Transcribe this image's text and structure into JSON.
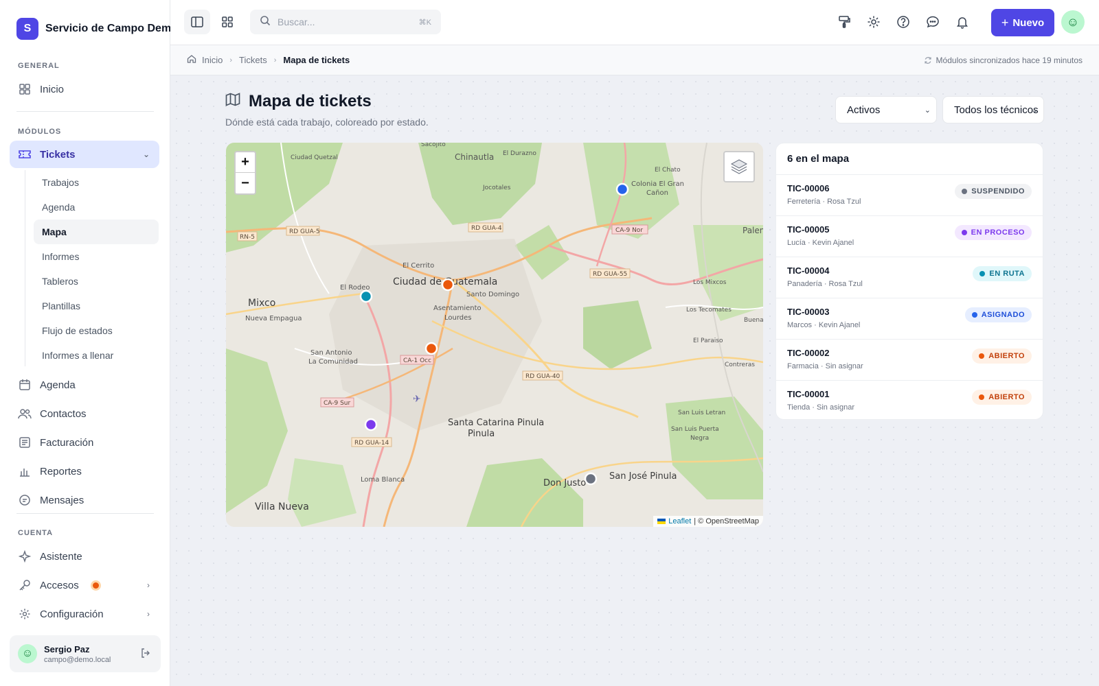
{
  "brand": {
    "logo_letter": "S",
    "name": "Servicio de Campo Demo"
  },
  "sidebar": {
    "general_label": "GENERAL",
    "inicio": "Inicio",
    "modulos_label": "MÓDULOS",
    "tickets": "Tickets",
    "tickets_sub": [
      "Trabajos",
      "Agenda",
      "Mapa",
      "Informes",
      "Tableros",
      "Plantillas",
      "Flujo de estados",
      "Informes a llenar"
    ],
    "modules": [
      "Agenda",
      "Contactos",
      "Facturación",
      "Reportes",
      "Mensajes"
    ],
    "cuenta_label": "CUENTA",
    "asistente": "Asistente",
    "accesos": "Accesos",
    "configuracion": "Configuración",
    "user": {
      "name": "Sergio Paz",
      "email": "campo@demo.local"
    }
  },
  "topbar": {
    "search_placeholder": "Buscar...",
    "search_shortcut": "⌘K",
    "new_label": "Nuevo"
  },
  "breadcrumb": {
    "home": "Inicio",
    "section": "Tickets",
    "current": "Mapa de tickets",
    "sync": "Módulos sincronizados hace 19 minutos"
  },
  "page": {
    "title": "Mapa de tickets",
    "subtitle": "Dónde está cada trabajo, coloreado por estado.",
    "filter_status": "Activos",
    "filter_tech": "Todos los técnicos"
  },
  "map": {
    "zoom_in": "+",
    "zoom_out": "−",
    "attribution_link": "Leaflet",
    "attribution_text": "| © OpenStreetMap",
    "labels": {
      "big": [
        "Ciudad de Guatemala",
        "Mixco",
        "Santa Catarina Pinula",
        "Villa Nueva",
        "San José Pinula",
        "Don Justo"
      ],
      "mid": [
        "Chinautla",
        "El Cerrito",
        "El Rodeo",
        "Santo Domingo",
        "Asentamiento Lourdes",
        "San Antonio La Comunidad",
        "Nueva Empagua",
        "Loma Blanca",
        "Colonia El Gran Cañon",
        "Los Mixcos",
        "Los Tecomates",
        "El Paraiso",
        "Contreras",
        "San Luis Letran",
        "San Luis Puerta Negra",
        "Ciudad Quetzal",
        "El Durazno",
        "Jocotales",
        "El Chato",
        "Sacojito",
        "Palenc",
        "Buena"
      ],
      "roads": [
        "RD GUA-5",
        "RN-5",
        "RD GUA-4",
        "CA-9 Nor",
        "RD GUA-55",
        "CA-1 Occ",
        "RD GUA-40",
        "CA-9 Sur",
        "RD GUA-14"
      ]
    }
  },
  "list": {
    "header": "6 en el mapa",
    "tickets": [
      {
        "id": "TIC-00006",
        "meta": "Ferretería · Rosa Tzul",
        "status": "SUSPENDIDO",
        "color": "#6b7280",
        "bg": "#f1f2f4",
        "fg": "#4b5563"
      },
      {
        "id": "TIC-00005",
        "meta": "Lucía · Kevin Ajanel",
        "status": "EN PROCESO",
        "color": "#7c3aed",
        "bg": "#f3e8ff",
        "fg": "#7c3aed"
      },
      {
        "id": "TIC-00004",
        "meta": "Panadería · Rosa Tzul",
        "status": "EN RUTA",
        "color": "#0891b2",
        "bg": "#e0f7fa",
        "fg": "#0e7490"
      },
      {
        "id": "TIC-00003",
        "meta": "Marcos · Kevin Ajanel",
        "status": "ASIGNADO",
        "color": "#2563eb",
        "bg": "#e6eeff",
        "fg": "#1d4ed8"
      },
      {
        "id": "TIC-00002",
        "meta": "Farmacia · Sin asignar",
        "status": "ABIERTO",
        "color": "#ea580c",
        "bg": "#fff1e6",
        "fg": "#c2410c"
      },
      {
        "id": "TIC-00001",
        "meta": "Tienda · Sin asignar",
        "status": "ABIERTO",
        "color": "#ea580c",
        "bg": "#fff1e6",
        "fg": "#c2410c"
      }
    ]
  },
  "colors": {
    "accent": "#4f46e5"
  }
}
